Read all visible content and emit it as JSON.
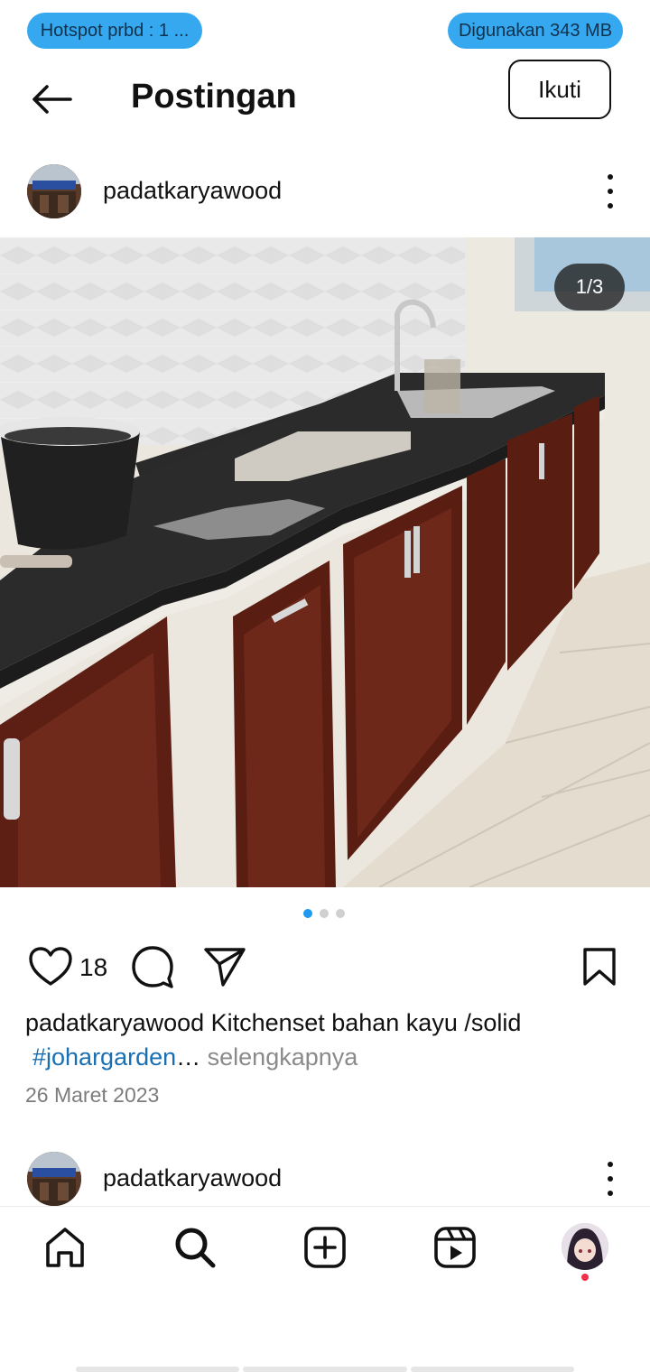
{
  "status": {
    "hotspot": "Hotspot prbd : 1 ...",
    "usage": "Digunakan 343 MB"
  },
  "header": {
    "title": "Postingan",
    "follow_label": "Ikuti"
  },
  "post": {
    "username": "padatkaryawood",
    "image_counter": "1/3",
    "carousel": {
      "current": 1,
      "total": 3
    },
    "likes": "18",
    "caption_user": "padatkaryawood",
    "caption_text": " Kitchenset bahan kayu /solid",
    "hashtag": "#johargarden",
    "ellipsis": "…",
    "more_label": " selengkapnya",
    "date": "26 Maret 2023"
  },
  "next_post": {
    "username": "padatkaryawood"
  },
  "colors": {
    "accent": "#1e9af0",
    "status_pill": "#35a8f0",
    "hashtag": "#1a6fb3",
    "notification": "#f0304a"
  },
  "icons": [
    "arrow-left-icon",
    "more-vertical-icon",
    "heart-icon",
    "comment-icon",
    "send-icon",
    "bookmark-icon",
    "home-icon",
    "search-icon",
    "add-post-icon",
    "reels-icon"
  ]
}
